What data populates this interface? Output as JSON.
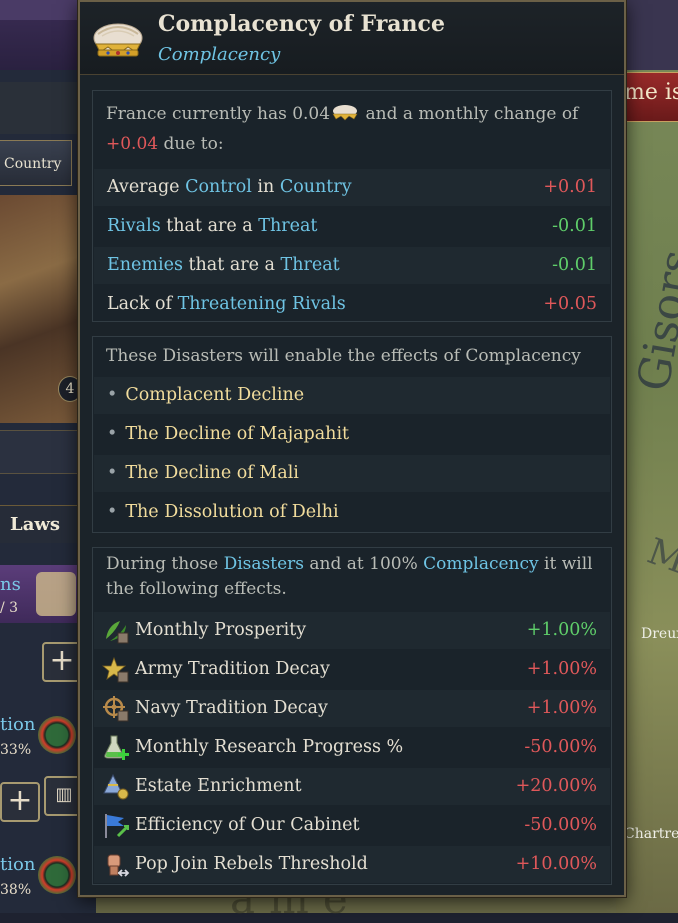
{
  "background": {
    "country_button": "Country",
    "portrait_badge": "4",
    "laws_tab": "Laws",
    "side_items": [
      {
        "text1": "ns",
        "text2": "/ 3"
      },
      {
        "text1": "tion",
        "text2": "33%"
      },
      {
        "text1": "tion",
        "text2": "38%"
      }
    ],
    "map_banner": "me is",
    "map_labels": [
      "Gisors",
      "Dreux",
      "Chartres",
      "M"
    ],
    "map_bottom": "ame"
  },
  "tooltip": {
    "title": "Complacency of France",
    "subtitle": "Complacency",
    "icon": "crown-icon",
    "summary": {
      "intro_prefix": "France currently has 0.04",
      "intro_mid": " and a monthly change of",
      "change": "+0.04",
      "intro_suffix": " due to:",
      "rows": [
        {
          "pre": "Average ",
          "k1": "Control",
          "mid": " in ",
          "k2": "Country",
          "value": "+0.01",
          "tone": "bad"
        },
        {
          "pre": "",
          "k1": "Rivals",
          "mid": " that are a ",
          "k2": "Threat",
          "value": "-0.01",
          "tone": "good"
        },
        {
          "pre": "",
          "k1": "Enemies",
          "mid": " that are a ",
          "k2": "Threat",
          "value": "-0.01",
          "tone": "good"
        },
        {
          "pre": "Lack of ",
          "k1": "Threatening Rivals",
          "mid": "",
          "k2": "",
          "value": "+0.05",
          "tone": "bad"
        }
      ]
    },
    "disasters": {
      "intro": "These Disasters will enable the effects of Complacency",
      "items": [
        "Complacent Decline",
        "The Decline of Majapahit",
        "The Decline of Mali",
        "The Dissolution of Delhi"
      ]
    },
    "effects": {
      "intro_a": "During those ",
      "intro_k1": "Disasters",
      "intro_b": " and at 100% ",
      "intro_k2": "Complacency",
      "intro_c": " it will",
      "intro_d": "the following effects.",
      "rows": [
        {
          "icon": "leaves-icon",
          "label": "Monthly Prosperity",
          "value": "+1.00%",
          "tone": "good"
        },
        {
          "icon": "star-icon",
          "label": "Army Tradition Decay",
          "value": "+1.00%",
          "tone": "bad"
        },
        {
          "icon": "ship-wheel-icon",
          "label": "Navy Tradition Decay",
          "value": "+1.00%",
          "tone": "bad"
        },
        {
          "icon": "flask-icon",
          "label": "Monthly Research Progress %",
          "value": "-50.00%",
          "tone": "bad"
        },
        {
          "icon": "pyramid-icon",
          "label": "Estate Enrichment",
          "value": "+20.00%",
          "tone": "bad"
        },
        {
          "icon": "flag-icon",
          "label": "Efficiency of Our Cabinet",
          "value": "-50.00%",
          "tone": "bad"
        },
        {
          "icon": "fist-icon",
          "label": "Pop Join Rebels Threshold",
          "value": "+10.00%",
          "tone": "bad"
        }
      ]
    }
  },
  "colors": {
    "keyword": "#6fc4e4",
    "bad": "#e0585a",
    "good": "#5fce6a",
    "disaster": "#f1dc9c"
  }
}
